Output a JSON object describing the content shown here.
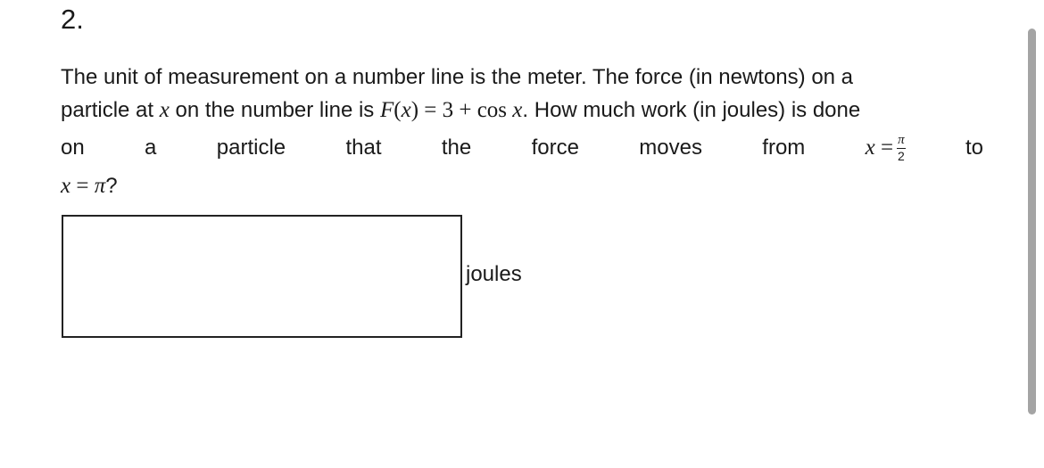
{
  "question": {
    "number": "2.",
    "line1": "The unit of measurement on a number line is the meter. The force (in newtons) on a",
    "line2": {
      "prefix": "particle at ",
      "var_x": "x",
      "middle": " on the number line is ",
      "func": "F",
      "paren_open": "(",
      "func_arg": "x",
      "paren_close": ")",
      "equals": " = 3 + cos ",
      "cos_var": "x",
      "suffix": ". How much work (in joules) is done"
    },
    "line3_words": [
      "on",
      "a",
      "particle",
      "that",
      "the",
      "force",
      "moves",
      "from"
    ],
    "line3_math": {
      "var": "x",
      "equals": " =",
      "numerator": "π",
      "denominator": "2"
    },
    "line3_end": "to",
    "line4": {
      "var": "x",
      "equals": " = ",
      "value": "π",
      "question_mark": "?"
    }
  },
  "answer": {
    "value": "",
    "placeholder": "",
    "unit": "joules"
  },
  "colors": {
    "text": "#1a1a1a",
    "box_border": "#222222",
    "scrollbar_thumb": "#a4a4a4"
  }
}
